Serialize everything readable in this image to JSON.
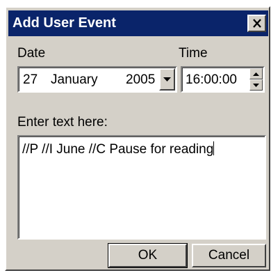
{
  "window": {
    "title": "Add User Event"
  },
  "date": {
    "label": "Date",
    "day": "27",
    "month": "January",
    "year": "2005"
  },
  "time": {
    "label": "Time",
    "value": "16:00:00"
  },
  "text_entry": {
    "label": "Enter text here:",
    "value": "//P //I June //C Pause for reading"
  },
  "buttons": {
    "ok": "OK",
    "cancel": "Cancel"
  },
  "icons": {
    "close": "close-icon",
    "dropdown": "chevron-down-icon",
    "spin_up": "arrow-up-icon",
    "spin_down": "arrow-down-icon"
  },
  "colors": {
    "titlebar": "#0a246a",
    "face": "#d4d0c8"
  }
}
